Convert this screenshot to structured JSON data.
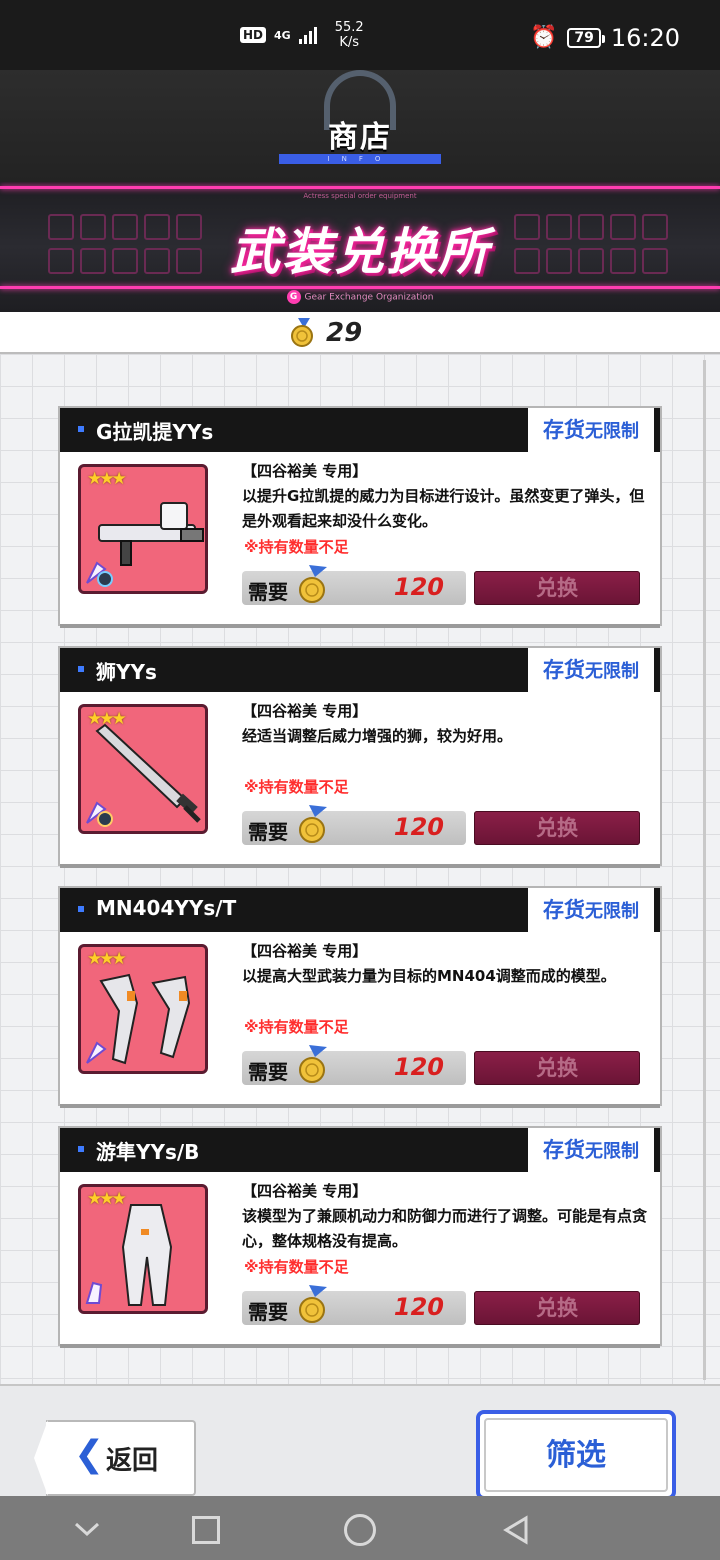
{
  "status_bar": {
    "hd": "HD",
    "network": "4G",
    "speed_value": "55.2",
    "speed_unit": "K/s",
    "battery": "79",
    "time": "16:20"
  },
  "header": {
    "title": "商店",
    "info_label": "INFO"
  },
  "banner": {
    "subtitle": "Actress special order equipment",
    "title": "武装兑换所",
    "org": "Gear Exchange Organization"
  },
  "currency": {
    "value": "29"
  },
  "cards": [
    {
      "name": "G拉凯提YYs",
      "stock_main": "存货",
      "stock_sub": "无限制",
      "owner": "【四谷裕美 专用】",
      "desc": "以提升G拉凯提的威力为目标进行设计。虽然变更了弹头，但是外观看起来却没什么变化。",
      "warning": "※持有数量不足",
      "need_label": "需要",
      "need_value": "120",
      "button": "兑换",
      "icon": "gun-icon"
    },
    {
      "name": "狮YYs",
      "stock_main": "存货",
      "stock_sub": "无限制",
      "owner": "【四谷裕美 专用】",
      "desc": "经适当调整后威力增强的狮，较为好用。",
      "warning": "※持有数量不足",
      "need_label": "需要",
      "need_value": "120",
      "button": "兑换",
      "icon": "sword-icon"
    },
    {
      "name": "MN404YYs/T",
      "stock_main": "存货",
      "stock_sub": "无限制",
      "owner": "【四谷裕美 专用】",
      "desc": "以提高大型武装力量为目标的MN404调整而成的模型。",
      "warning": "※持有数量不足",
      "need_label": "需要",
      "need_value": "120",
      "button": "兑换",
      "icon": "gauntlet-icon"
    },
    {
      "name": "游隼YYs/B",
      "stock_main": "存货",
      "stock_sub": "无限制",
      "owner": "【四谷裕美 专用】",
      "desc": "该模型为了兼顾机动力和防御力而进行了调整。可能是有点贪心，整体规格没有提高。",
      "warning": "※持有数量不足",
      "need_label": "需要",
      "need_value": "120",
      "button": "兑换",
      "icon": "armor-icon"
    }
  ],
  "footer": {
    "back_label": "返回",
    "filter_label": "筛选"
  },
  "colors": {
    "accent_blue": "#2b5fd6",
    "exchange_button": "#7a1a3f",
    "banner_pink": "#ff3db1",
    "warning_red": "#ff2f2f",
    "thumb_bg": "#f1667b"
  }
}
